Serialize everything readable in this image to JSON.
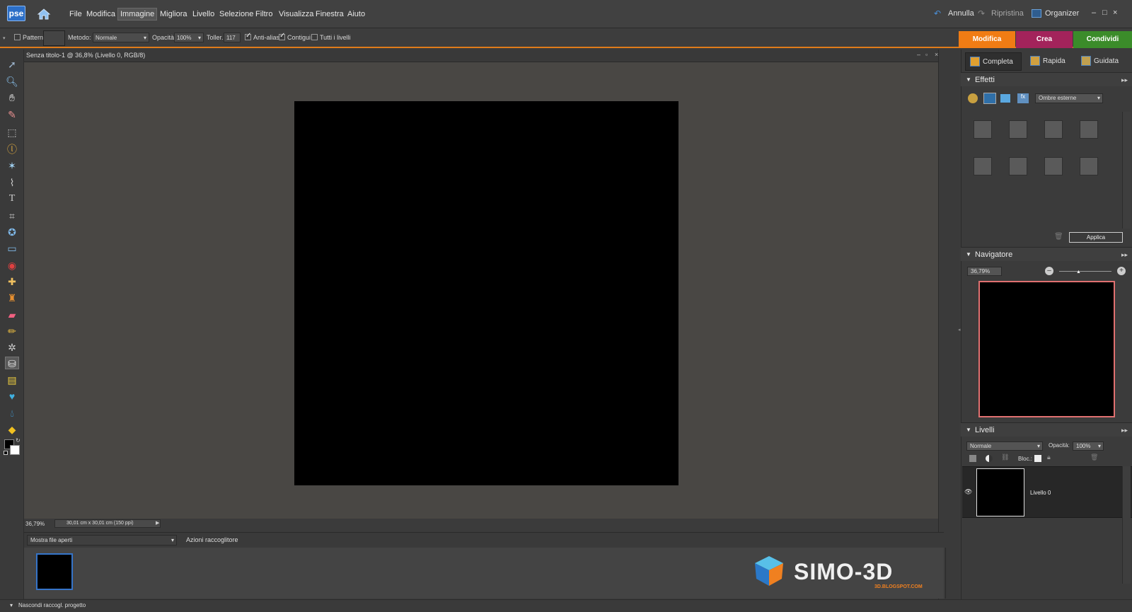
{
  "app": {
    "logo_text": "pse"
  },
  "menu": {
    "items": [
      "File",
      "Modifica",
      "Immagine",
      "Migliora",
      "Livello",
      "Selezione",
      "Filtro",
      "Visualizza",
      "Finestra",
      "Aiuto"
    ],
    "undo": "Annulla",
    "redo": "Ripristina",
    "organizer": "Organizer"
  },
  "options": {
    "pattern_label": "Pattern",
    "method_label": "Metodo:",
    "method_value": "Normale",
    "opacity_label": "Opacità:",
    "opacity_value": "100%",
    "tolerance_label": "Toller.:",
    "tolerance_value": "117",
    "antialias_label": "Anti-alias",
    "contiguous_label": "Contigui",
    "all_layers_label": "Tutti i livelli"
  },
  "modes": {
    "edit": "Modifica",
    "create": "Crea",
    "share": "Condividi"
  },
  "edit_tabs": {
    "full": "Completa",
    "quick": "Rapida",
    "guided": "Guidata"
  },
  "document": {
    "title": "Senza titolo-1 @ 36,8% (Livello 0, RGB/8)",
    "zoom": "36,79%",
    "size_info": "30,01 cm x 30,01 cm (150 ppi)"
  },
  "bin": {
    "show_files": "Mostra file aperti",
    "actions": "Azioni raccoglitore",
    "hide": "Nascondi raccogl. progetto"
  },
  "effects": {
    "title": "Effetti",
    "category": "Ombre esterne",
    "apply": "Applica"
  },
  "navigator": {
    "title": "Navigatore",
    "zoom": "36,79%"
  },
  "layers": {
    "title": "Livelli",
    "blend_mode": "Normale",
    "opacity_label": "Opacità:",
    "opacity_value": "100%",
    "lock_label": "Bloc.:",
    "layer_name": "Livello 0"
  },
  "watermark": {
    "brand": "SIMO-3D",
    "sub": "3D.BLOGSPOT.COM"
  },
  "colors": {
    "edit_tab": "#f07c14",
    "create_tab": "#a3235b",
    "share_tab": "#3b8c2a",
    "accent_line": "#e07b1a",
    "navigator_frame": "#e07070",
    "arrow": "#e8181a"
  }
}
